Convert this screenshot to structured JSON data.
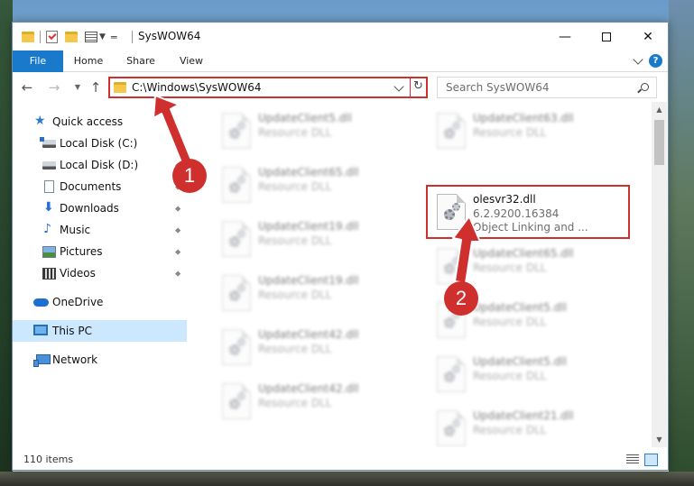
{
  "window": {
    "title": "SysWOW64",
    "minimize_label": "—",
    "close_label": "✕"
  },
  "ribbon": {
    "tabs": [
      {
        "label": "File"
      },
      {
        "label": "Home"
      },
      {
        "label": "Share"
      },
      {
        "label": "View"
      }
    ],
    "help_label": "?"
  },
  "nav": {
    "back_label": "←",
    "forward_label": "→",
    "recent_label": "▼",
    "up_label": "↑",
    "address": "C:\\Windows\\SysWOW64",
    "refresh_label": "↻",
    "search_placeholder": "Search SysWOW64"
  },
  "sidebar": {
    "items": [
      {
        "label": "Quick access",
        "icon": "star-icon"
      },
      {
        "label": "Local Disk (C:)",
        "icon": "drive-icon"
      },
      {
        "label": "Local Disk (D:)",
        "icon": "drive-icon"
      },
      {
        "label": "Documents",
        "icon": "documents-icon"
      },
      {
        "label": "Downloads",
        "icon": "download-icon"
      },
      {
        "label": "Music",
        "icon": "music-icon"
      },
      {
        "label": "Pictures",
        "icon": "pictures-icon"
      },
      {
        "label": "Videos",
        "icon": "videos-icon"
      },
      {
        "label": "OneDrive",
        "icon": "cloud-icon"
      },
      {
        "label": "This PC",
        "icon": "computer-icon"
      },
      {
        "label": "Network",
        "icon": "network-icon"
      }
    ],
    "pin_glyph": "📌"
  },
  "files": {
    "left": [
      {
        "name": "UpdateClient5.dll",
        "type": "Resource DLL"
      },
      {
        "name": "UpdateClient65.dll",
        "type": "Resource DLL"
      },
      {
        "name": "UpdateClient19.dll",
        "type": "Resource DLL"
      },
      {
        "name": "UpdateClient19.dll",
        "type": "Resource DLL"
      },
      {
        "name": "UpdateClient42.dll",
        "type": "Resource DLL"
      },
      {
        "name": "UpdateClient42.dll",
        "type": "Resource DLL"
      }
    ],
    "right": [
      {
        "name": "UpdateClient63.dll",
        "type": "Resource DLL"
      },
      {
        "name": "olesvr32.dll",
        "version": "6.2.9200.16384",
        "type": "Object Linking and ..."
      },
      {
        "name": "UpdateClient65.dll",
        "type": "Resource DLL"
      },
      {
        "name": "UpdateClient5.dll",
        "type": "Resource DLL"
      },
      {
        "name": "UpdateClient5.dll",
        "type": "Resource DLL"
      },
      {
        "name": "UpdateClient21.dll",
        "type": "Resource DLL"
      }
    ]
  },
  "status": {
    "item_count": "110 items"
  },
  "annotations": {
    "step1": "1",
    "step2": "2",
    "color": "#d0302d"
  },
  "colors": {
    "accent": "#1979ca",
    "selection": "#cce8ff"
  }
}
